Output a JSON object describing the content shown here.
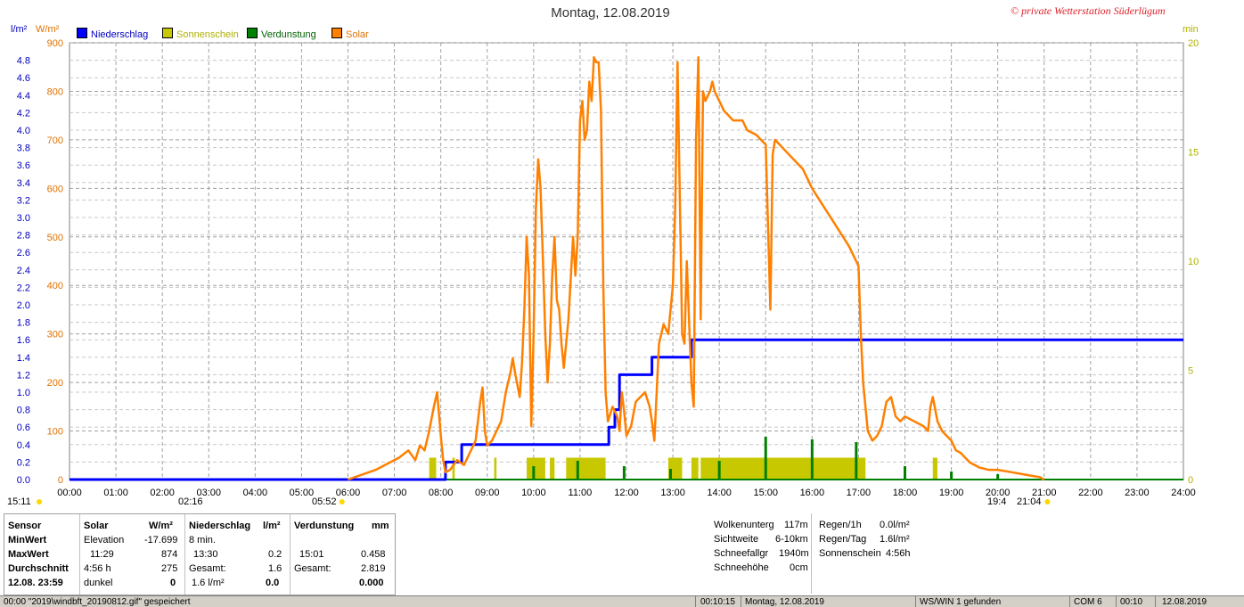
{
  "title": "Montag, 12.08.2019",
  "copyright": "© private Wetterstation Süderlügum",
  "left_axis_unit": "l/m²",
  "right_solar_unit": "W/m²",
  "right_axis_unit": "min",
  "legend": [
    {
      "label": "Niederschlag",
      "color": "#0000ff"
    },
    {
      "label": "Sonnenschein",
      "color": "#c8c800"
    },
    {
      "label": "Verdunstung",
      "color": "#008000"
    },
    {
      "label": "Solar",
      "color": "#ff8000"
    }
  ],
  "markers": {
    "sunrise_left": "15:11",
    "moon_time": "02:16",
    "sunrise": "05:52",
    "sunset_left": "19:4",
    "sunset": "21:04"
  },
  "chart_data": {
    "type": "line",
    "xlabel": "",
    "x_ticks": [
      "00:00",
      "01:00",
      "02:00",
      "03:00",
      "04:00",
      "05:00",
      "06:00",
      "07:00",
      "08:00",
      "09:00",
      "10:00",
      "11:00",
      "12:00",
      "13:00",
      "14:00",
      "15:00",
      "16:00",
      "17:00",
      "18:00",
      "19:00",
      "20:00",
      "21:00",
      "22:00",
      "23:00",
      "24:00"
    ],
    "xlim": [
      0,
      24
    ],
    "precip_axis": {
      "label": "l/m²",
      "ticks": [
        "0.0",
        "0.2",
        "0.4",
        "0.6",
        "0.8",
        "1.0",
        "1.2",
        "1.4",
        "1.6",
        "1.8",
        "2.0",
        "2.2",
        "2.4",
        "2.6",
        "2.8",
        "3.0",
        "3.2",
        "3.4",
        "3.6",
        "3.8",
        "4.0",
        "4.2",
        "4.4",
        "4.6",
        "4.8"
      ],
      "ylim": [
        0,
        5.0
      ]
    },
    "solar_axis": {
      "label": "W/m²",
      "ticks": [
        "0",
        "100",
        "200",
        "300",
        "400",
        "500",
        "600",
        "700",
        "800",
        "900"
      ],
      "ylim": [
        0,
        900
      ]
    },
    "minutes_axis": {
      "label": "min",
      "ticks": [
        "0",
        "5",
        "10",
        "15",
        "20"
      ],
      "ylim": [
        0,
        20
      ]
    },
    "series": [
      {
        "name": "Niederschlag",
        "color": "#0000ff",
        "axis": "precip",
        "points": [
          [
            0,
            0
          ],
          [
            8.1,
            0
          ],
          [
            8.1,
            0.2
          ],
          [
            8.45,
            0.2
          ],
          [
            8.45,
            0.4
          ],
          [
            11.62,
            0.4
          ],
          [
            11.62,
            0.6
          ],
          [
            11.75,
            0.6
          ],
          [
            11.75,
            0.8
          ],
          [
            11.85,
            0.8
          ],
          [
            11.85,
            1.2
          ],
          [
            12.55,
            1.2
          ],
          [
            12.55,
            1.4
          ],
          [
            13.4,
            1.4
          ],
          [
            13.4,
            1.6
          ],
          [
            24,
            1.6
          ]
        ]
      },
      {
        "name": "Solar",
        "color": "#ff8000",
        "axis": "solar",
        "points": [
          [
            6.0,
            0
          ],
          [
            6.3,
            10
          ],
          [
            6.6,
            20
          ],
          [
            6.9,
            35
          ],
          [
            7.1,
            45
          ],
          [
            7.3,
            60
          ],
          [
            7.45,
            40
          ],
          [
            7.55,
            70
          ],
          [
            7.65,
            60
          ],
          [
            7.75,
            100
          ],
          [
            7.85,
            150
          ],
          [
            7.92,
            180
          ],
          [
            8.0,
            90
          ],
          [
            8.05,
            40
          ],
          [
            8.1,
            15
          ],
          [
            8.2,
            20
          ],
          [
            8.35,
            40
          ],
          [
            8.5,
            30
          ],
          [
            8.65,
            60
          ],
          [
            8.75,
            80
          ],
          [
            8.85,
            160
          ],
          [
            8.9,
            190
          ],
          [
            8.95,
            100
          ],
          [
            9.0,
            70
          ],
          [
            9.1,
            80
          ],
          [
            9.2,
            100
          ],
          [
            9.3,
            120
          ],
          [
            9.4,
            180
          ],
          [
            9.5,
            220
          ],
          [
            9.55,
            250
          ],
          [
            9.6,
            220
          ],
          [
            9.7,
            170
          ],
          [
            9.75,
            240
          ],
          [
            9.8,
            350
          ],
          [
            9.85,
            500
          ],
          [
            9.9,
            420
          ],
          [
            9.95,
            110
          ],
          [
            10.0,
            300
          ],
          [
            10.05,
            560
          ],
          [
            10.1,
            660
          ],
          [
            10.15,
            600
          ],
          [
            10.2,
            450
          ],
          [
            10.25,
            300
          ],
          [
            10.3,
            200
          ],
          [
            10.35,
            280
          ],
          [
            10.4,
            420
          ],
          [
            10.45,
            500
          ],
          [
            10.5,
            370
          ],
          [
            10.55,
            350
          ],
          [
            10.6,
            280
          ],
          [
            10.65,
            230
          ],
          [
            10.75,
            330
          ],
          [
            10.85,
            500
          ],
          [
            10.9,
            420
          ],
          [
            10.95,
            500
          ],
          [
            11.0,
            740
          ],
          [
            11.05,
            780
          ],
          [
            11.1,
            700
          ],
          [
            11.15,
            720
          ],
          [
            11.2,
            820
          ],
          [
            11.25,
            780
          ],
          [
            11.3,
            870
          ],
          [
            11.35,
            860
          ],
          [
            11.4,
            860
          ],
          [
            11.45,
            760
          ],
          [
            11.5,
            400
          ],
          [
            11.55,
            180
          ],
          [
            11.6,
            120
          ],
          [
            11.7,
            150
          ],
          [
            11.8,
            130
          ],
          [
            11.85,
            100
          ],
          [
            11.9,
            180
          ],
          [
            11.95,
            140
          ],
          [
            12.0,
            90
          ],
          [
            12.1,
            110
          ],
          [
            12.2,
            160
          ],
          [
            12.3,
            170
          ],
          [
            12.4,
            180
          ],
          [
            12.5,
            150
          ],
          [
            12.55,
            120
          ],
          [
            12.6,
            80
          ],
          [
            12.7,
            280
          ],
          [
            12.8,
            320
          ],
          [
            12.9,
            300
          ],
          [
            13.0,
            400
          ],
          [
            13.05,
            560
          ],
          [
            13.1,
            860
          ],
          [
            13.15,
            580
          ],
          [
            13.2,
            300
          ],
          [
            13.25,
            280
          ],
          [
            13.3,
            450
          ],
          [
            13.4,
            200
          ],
          [
            13.45,
            150
          ],
          [
            13.5,
            700
          ],
          [
            13.55,
            870
          ],
          [
            13.6,
            330
          ],
          [
            13.65,
            800
          ],
          [
            13.7,
            780
          ],
          [
            13.8,
            800
          ],
          [
            13.85,
            820
          ],
          [
            13.9,
            800
          ],
          [
            14.0,
            780
          ],
          [
            14.1,
            760
          ],
          [
            14.3,
            740
          ],
          [
            14.5,
            740
          ],
          [
            14.6,
            720
          ],
          [
            14.8,
            710
          ],
          [
            14.9,
            700
          ],
          [
            15.0,
            690
          ],
          [
            15.1,
            350
          ],
          [
            15.15,
            670
          ],
          [
            15.2,
            700
          ],
          [
            15.3,
            690
          ],
          [
            15.4,
            680
          ],
          [
            15.6,
            660
          ],
          [
            15.8,
            640
          ],
          [
            16.0,
            600
          ],
          [
            16.2,
            570
          ],
          [
            16.4,
            540
          ],
          [
            16.6,
            510
          ],
          [
            16.8,
            480
          ],
          [
            16.9,
            460
          ],
          [
            17.0,
            440
          ],
          [
            17.05,
            300
          ],
          [
            17.1,
            200
          ],
          [
            17.15,
            150
          ],
          [
            17.2,
            100
          ],
          [
            17.3,
            80
          ],
          [
            17.4,
            90
          ],
          [
            17.5,
            110
          ],
          [
            17.6,
            160
          ],
          [
            17.7,
            170
          ],
          [
            17.8,
            130
          ],
          [
            17.9,
            120
          ],
          [
            18.0,
            130
          ],
          [
            18.2,
            120
          ],
          [
            18.4,
            110
          ],
          [
            18.5,
            100
          ],
          [
            18.55,
            150
          ],
          [
            18.6,
            170
          ],
          [
            18.7,
            120
          ],
          [
            18.8,
            100
          ],
          [
            18.9,
            90
          ],
          [
            19.0,
            80
          ],
          [
            19.1,
            60
          ],
          [
            19.2,
            55
          ],
          [
            19.4,
            35
          ],
          [
            19.6,
            25
          ],
          [
            19.8,
            20
          ],
          [
            20.0,
            20
          ],
          [
            20.3,
            15
          ],
          [
            20.6,
            10
          ],
          [
            20.9,
            5
          ],
          [
            21.0,
            0
          ]
        ]
      }
    ],
    "sunshine_bars": [
      [
        7.75,
        7.9
      ],
      [
        8.25,
        8.3
      ],
      [
        9.15,
        9.2
      ],
      [
        9.85,
        10.25
      ],
      [
        10.35,
        10.45
      ],
      [
        10.7,
        11.55
      ],
      [
        12.9,
        13.2
      ],
      [
        13.4,
        13.55
      ],
      [
        13.6,
        17.15
      ],
      [
        18.6,
        18.7
      ]
    ],
    "evaporation_bars": [
      [
        10.0,
        5
      ],
      [
        10.95,
        7
      ],
      [
        11.95,
        5
      ],
      [
        12.95,
        4
      ],
      [
        14.0,
        7
      ],
      [
        15.0,
        16
      ],
      [
        16.0,
        15
      ],
      [
        16.95,
        14
      ],
      [
        18.0,
        5
      ],
      [
        19.0,
        3
      ],
      [
        20.0,
        2
      ]
    ]
  },
  "stats_panel": {
    "sensor": {
      "header": "Sensor",
      "rows": [
        "MinWert",
        "MaxWert",
        "Durchschnitt",
        "12.08.  23:59"
      ]
    },
    "solar": {
      "header": "Solar",
      "unit": "W/m²",
      "rows": [
        [
          "Elevation",
          "-17.699"
        ],
        [
          "11:29",
          "874"
        ],
        [
          "4:56 h",
          "275"
        ],
        [
          "dunkel",
          "0"
        ]
      ]
    },
    "precip": {
      "header": "Niederschlag",
      "unit": "l/m²",
      "rows": [
        [
          "8 min.",
          ""
        ],
        [
          "13:30",
          "0.2"
        ],
        [
          "Gesamt:",
          "1.6"
        ],
        [
          "1.6 l/m²",
          "0.0"
        ]
      ]
    },
    "evap": {
      "header": "Verdunstung",
      "unit": "mm",
      "rows": [
        [
          "",
          ""
        ],
        [
          "15:01",
          "0.458"
        ],
        [
          "Gesamt:",
          "2.819"
        ],
        [
          "",
          "0.000"
        ]
      ]
    },
    "clouds": {
      "rows": [
        [
          "Wolkenunterg",
          "117m"
        ],
        [
          "Sichtweite",
          "6-10km"
        ],
        [
          "Schneefallgr",
          "1940m"
        ],
        [
          "Schneehöhe",
          "0cm"
        ]
      ]
    },
    "rain": {
      "rows": [
        [
          "Regen/1h",
          "0.0l/m²"
        ],
        [
          "Regen/Tag",
          "1.6l/m²"
        ],
        [
          "Sonnenschein",
          "4:56h"
        ]
      ]
    }
  },
  "status_bar": {
    "msg": "00:00  \"2019\\windbft_20190812.gif\" gespeichert",
    "time": "00:10:15",
    "date": "Montag, 12.08.2019",
    "ws": "WS/WIN 1 gefunden",
    "com": "COM 6",
    "t2": "00:10",
    "d2": "12.08.2019"
  }
}
